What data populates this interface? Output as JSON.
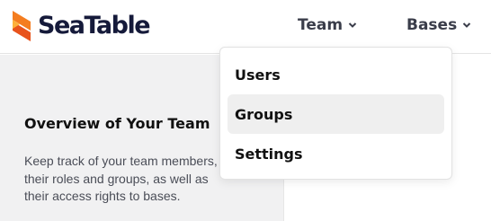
{
  "header": {
    "logo_text": "SeaTable",
    "nav": [
      {
        "label": "Team"
      },
      {
        "label": "Bases"
      }
    ]
  },
  "dropdown": {
    "items": [
      {
        "label": "Users"
      },
      {
        "label": "Groups"
      },
      {
        "label": "Settings"
      }
    ]
  },
  "content": {
    "title": "Overview of Your Team",
    "description": "Keep track of your team members, their roles and groups, as well as their access rights to bases."
  },
  "colors": {
    "brand_orange": "#f47d20",
    "brand_orange_dark": "#e8531c",
    "logo_text": "#151a3a",
    "content_bg": "#f1f1f2"
  },
  "icons": [
    "seatable-logo-icon",
    "chevron-down-icon"
  ]
}
